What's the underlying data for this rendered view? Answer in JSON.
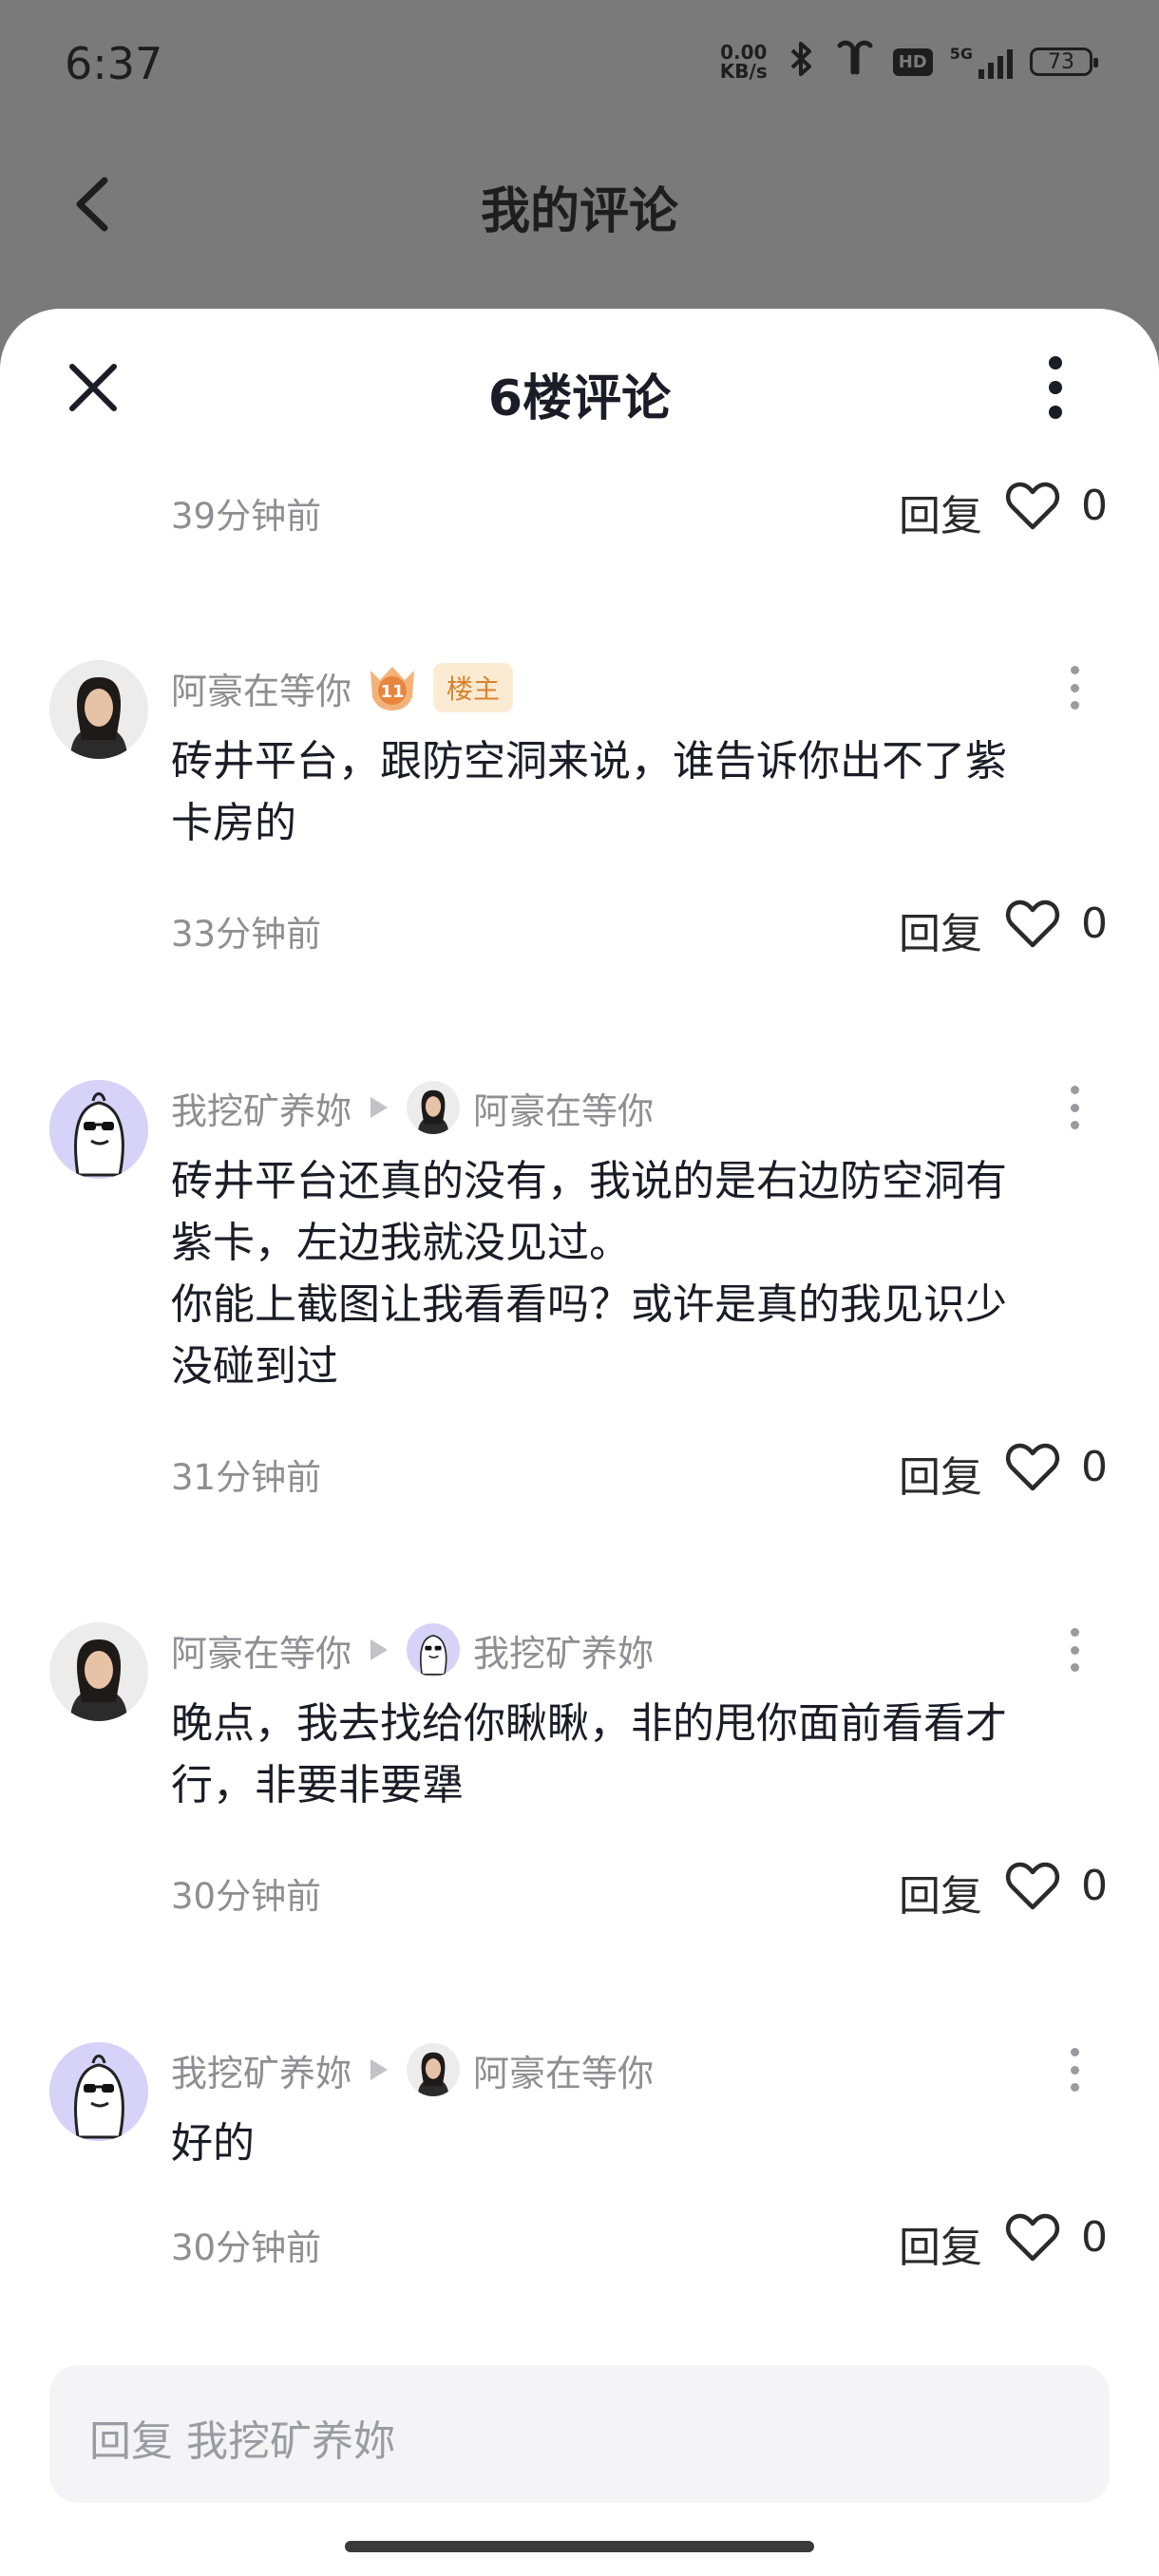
{
  "status_bar": {
    "time": "6:37",
    "net_speed_value": "0.00",
    "net_speed_unit": "KB/s",
    "hd": "HD",
    "network": "5G",
    "battery": "73"
  },
  "header": {
    "title": "我的评论"
  },
  "sheet": {
    "title": "6楼评论",
    "first_footer": {
      "time": "39分钟前",
      "reply": "回复",
      "likes": "0"
    },
    "reply_placeholder": "回复 我挖矿养妳"
  },
  "comments": [
    {
      "author": "阿豪在等你",
      "level": "11",
      "badge": "楼主",
      "text": "砖井平台，跟防空洞来说，谁告诉你出不了紫\n卡房的",
      "time": "33分钟前",
      "reply": "回复",
      "likes": "0"
    },
    {
      "author": "我挖矿养妳",
      "reply_to": "阿豪在等你",
      "text": "砖井平台还真的没有，我说的是右边防空洞有\n紫卡，左边我就没见过。\n你能上截图让我看看吗？或许是真的我见识少\n没碰到过",
      "time": "31分钟前",
      "reply": "回复",
      "likes": "0"
    },
    {
      "author": "阿豪在等你",
      "reply_to": "我挖矿养妳",
      "text": "晚点，我去找给你瞅瞅，非的甩你面前看看才\n行，非要非要犟",
      "time": "30分钟前",
      "reply": "回复",
      "likes": "0"
    },
    {
      "author": "我挖矿养妳",
      "reply_to": "阿豪在等你",
      "text": "好的",
      "time": "30分钟前",
      "reply": "回复",
      "likes": "0"
    }
  ],
  "icons": {
    "back": "chevron-left-icon",
    "close": "close-icon",
    "more": "more-vertical-icon",
    "like": "heart-icon",
    "bluetooth": "bluetooth-icon",
    "earbuds": "earbuds-icon"
  },
  "colors": {
    "overlay": "#7a7a7a",
    "host_tag_bg": "#fcebd3",
    "host_tag_text": "#d9822b",
    "mascot_bg": "#d7d2f7",
    "meta_text": "#8e8e93"
  }
}
